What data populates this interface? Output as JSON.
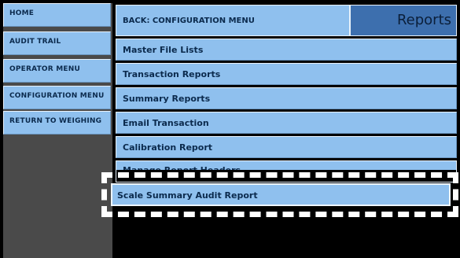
{
  "sidebar": {
    "items": [
      {
        "label": "HOME"
      },
      {
        "label": "AUDIT TRAIL"
      },
      {
        "label": "OPERATOR MENU"
      },
      {
        "label": "CONFIGURATION MENU"
      },
      {
        "label": "RETURN TO WEIGHING"
      }
    ]
  },
  "header": {
    "back_label": "BACK: CONFIGURATION MENU",
    "title": "Reports"
  },
  "menu": {
    "items": [
      {
        "label": "Master File Lists"
      },
      {
        "label": "Transaction Reports"
      },
      {
        "label": "Summary Reports"
      },
      {
        "label": "Email Transaction"
      },
      {
        "label": "Calibration Report"
      },
      {
        "label": "Manage Report Headers"
      },
      {
        "label": "Scale Summary Audit Report"
      }
    ]
  },
  "colors": {
    "button_fill": "#8fc0ee",
    "title_fill": "#3d6fae",
    "sidebar_bg": "#4a4a4a",
    "highlight_border": "#ffffff"
  }
}
